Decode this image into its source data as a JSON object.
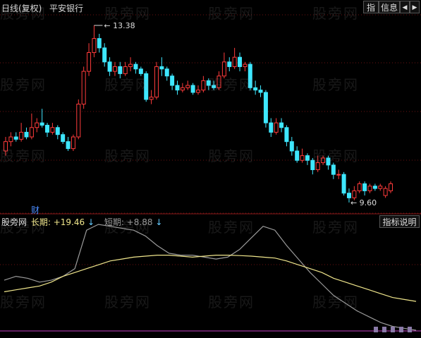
{
  "topbar": {
    "period_label": "日线(复权)",
    "stock_name": "平安银行",
    "btn_index": "指",
    "btn_info": "信息",
    "btn_prev": "◀",
    "btn_next": "▶"
  },
  "price_chart": {
    "high_label": "13.38",
    "low_label": "9.60",
    "high_value": 13.38,
    "low_value": 9.6,
    "finance_marker": "财",
    "colors": {
      "up": "#ff3b3b",
      "down": "#3ee7ff",
      "grid": "#6b1212"
    },
    "candles": [
      {
        "o": 10.7,
        "c": 10.9,
        "h": 11.0,
        "l": 10.6
      },
      {
        "o": 10.9,
        "c": 11.0,
        "h": 11.1,
        "l": 10.8
      },
      {
        "o": 11.0,
        "c": 10.95,
        "h": 11.1,
        "l": 10.9
      },
      {
        "o": 10.95,
        "c": 11.1,
        "h": 11.3,
        "l": 10.9
      },
      {
        "o": 11.1,
        "c": 11.0,
        "h": 11.2,
        "l": 10.95
      },
      {
        "o": 11.0,
        "c": 11.2,
        "h": 11.5,
        "l": 10.95
      },
      {
        "o": 11.2,
        "c": 11.3,
        "h": 11.4,
        "l": 11.1
      },
      {
        "o": 11.3,
        "c": 11.25,
        "h": 11.6,
        "l": 11.2
      },
      {
        "o": 11.25,
        "c": 11.1,
        "h": 11.3,
        "l": 11.0
      },
      {
        "o": 11.1,
        "c": 11.2,
        "h": 11.3,
        "l": 11.05
      },
      {
        "o": 11.2,
        "c": 11.05,
        "h": 11.25,
        "l": 10.95
      },
      {
        "o": 11.05,
        "c": 10.9,
        "h": 11.1,
        "l": 10.85
      },
      {
        "o": 10.9,
        "c": 10.75,
        "h": 11.0,
        "l": 10.7
      },
      {
        "o": 10.75,
        "c": 11.0,
        "h": 11.05,
        "l": 10.7
      },
      {
        "o": 11.0,
        "c": 11.7,
        "h": 11.8,
        "l": 10.95
      },
      {
        "o": 11.7,
        "c": 12.4,
        "h": 12.5,
        "l": 11.6
      },
      {
        "o": 12.4,
        "c": 12.8,
        "h": 13.0,
        "l": 12.3
      },
      {
        "o": 12.8,
        "c": 13.1,
        "h": 13.38,
        "l": 12.7
      },
      {
        "o": 13.1,
        "c": 12.9,
        "h": 13.2,
        "l": 12.8
      },
      {
        "o": 12.9,
        "c": 12.6,
        "h": 13.0,
        "l": 12.5
      },
      {
        "o": 12.6,
        "c": 12.4,
        "h": 12.7,
        "l": 12.3
      },
      {
        "o": 12.4,
        "c": 12.5,
        "h": 12.6,
        "l": 12.3
      },
      {
        "o": 12.5,
        "c": 12.35,
        "h": 12.6,
        "l": 12.25
      },
      {
        "o": 12.35,
        "c": 12.5,
        "h": 12.6,
        "l": 12.3
      },
      {
        "o": 12.5,
        "c": 12.55,
        "h": 12.7,
        "l": 12.4
      },
      {
        "o": 12.55,
        "c": 12.45,
        "h": 12.6,
        "l": 12.35
      },
      {
        "o": 12.45,
        "c": 12.35,
        "h": 12.5,
        "l": 12.3
      },
      {
        "o": 12.35,
        "c": 11.8,
        "h": 12.4,
        "l": 11.75
      },
      {
        "o": 11.8,
        "c": 11.85,
        "h": 12.0,
        "l": 11.7
      },
      {
        "o": 11.85,
        "c": 12.5,
        "h": 12.6,
        "l": 11.8
      },
      {
        "o": 12.5,
        "c": 12.45,
        "h": 12.7,
        "l": 12.3
      },
      {
        "o": 12.45,
        "c": 12.3,
        "h": 12.5,
        "l": 12.2
      },
      {
        "o": 12.3,
        "c": 12.1,
        "h": 12.35,
        "l": 12.0
      },
      {
        "o": 12.1,
        "c": 12.0,
        "h": 12.2,
        "l": 11.9
      },
      {
        "o": 12.0,
        "c": 12.05,
        "h": 12.15,
        "l": 11.95
      },
      {
        "o": 12.05,
        "c": 12.1,
        "h": 12.2,
        "l": 12.0
      },
      {
        "o": 12.1,
        "c": 11.95,
        "h": 12.15,
        "l": 11.9
      },
      {
        "o": 11.95,
        "c": 12.0,
        "h": 12.1,
        "l": 11.9
      },
      {
        "o": 12.0,
        "c": 12.2,
        "h": 12.3,
        "l": 11.95
      },
      {
        "o": 12.2,
        "c": 12.1,
        "h": 12.25,
        "l": 12.0
      },
      {
        "o": 12.1,
        "c": 12.05,
        "h": 12.2,
        "l": 12.0
      },
      {
        "o": 12.05,
        "c": 12.3,
        "h": 12.4,
        "l": 12.0
      },
      {
        "o": 12.3,
        "c": 12.6,
        "h": 12.8,
        "l": 12.25
      },
      {
        "o": 12.6,
        "c": 12.5,
        "h": 12.7,
        "l": 12.4
      },
      {
        "o": 12.5,
        "c": 12.7,
        "h": 12.9,
        "l": 12.45
      },
      {
        "o": 12.7,
        "c": 12.5,
        "h": 12.8,
        "l": 12.4
      },
      {
        "o": 12.5,
        "c": 12.55,
        "h": 12.6,
        "l": 12.4
      },
      {
        "o": 12.55,
        "c": 12.05,
        "h": 12.6,
        "l": 12.0
      },
      {
        "o": 12.05,
        "c": 12.0,
        "h": 12.2,
        "l": 11.9
      },
      {
        "o": 12.0,
        "c": 11.95,
        "h": 12.1,
        "l": 11.85
      },
      {
        "o": 11.95,
        "c": 11.3,
        "h": 12.0,
        "l": 11.2
      },
      {
        "o": 11.3,
        "c": 11.1,
        "h": 11.4,
        "l": 11.0
      },
      {
        "o": 11.1,
        "c": 11.3,
        "h": 11.4,
        "l": 11.05
      },
      {
        "o": 11.3,
        "c": 11.2,
        "h": 11.4,
        "l": 11.1
      },
      {
        "o": 11.2,
        "c": 10.9,
        "h": 11.25,
        "l": 10.8
      },
      {
        "o": 10.9,
        "c": 10.7,
        "h": 11.0,
        "l": 10.6
      },
      {
        "o": 10.7,
        "c": 10.5,
        "h": 10.8,
        "l": 10.45
      },
      {
        "o": 10.5,
        "c": 10.6,
        "h": 10.75,
        "l": 10.45
      },
      {
        "o": 10.6,
        "c": 10.5,
        "h": 10.65,
        "l": 10.4
      },
      {
        "o": 10.5,
        "c": 10.3,
        "h": 10.55,
        "l": 10.2
      },
      {
        "o": 10.3,
        "c": 10.45,
        "h": 10.6,
        "l": 10.25
      },
      {
        "o": 10.45,
        "c": 10.55,
        "h": 10.6,
        "l": 10.4
      },
      {
        "o": 10.55,
        "c": 10.4,
        "h": 10.6,
        "l": 10.3
      },
      {
        "o": 10.4,
        "c": 10.2,
        "h": 10.45,
        "l": 10.1
      },
      {
        "o": 10.2,
        "c": 10.2,
        "h": 10.3,
        "l": 10.1
      },
      {
        "o": 10.2,
        "c": 9.8,
        "h": 10.25,
        "l": 9.75
      },
      {
        "o": 9.8,
        "c": 9.7,
        "h": 9.9,
        "l": 9.6
      },
      {
        "o": 9.7,
        "c": 9.85,
        "h": 9.95,
        "l": 9.65
      },
      {
        "o": 9.85,
        "c": 10.0,
        "h": 10.05,
        "l": 9.8
      },
      {
        "o": 10.0,
        "c": 9.85,
        "h": 10.05,
        "l": 9.75
      },
      {
        "o": 9.85,
        "c": 9.95,
        "h": 10.0,
        "l": 9.8
      },
      {
        "o": 9.95,
        "c": 9.9,
        "h": 10.0,
        "l": 9.85
      },
      {
        "o": 9.9,
        "c": 9.95,
        "h": 10.0,
        "l": 9.85
      },
      {
        "o": 9.75,
        "c": 9.9,
        "h": 9.95,
        "l": 9.7
      },
      {
        "o": 9.85,
        "c": 10.0,
        "h": 10.05,
        "l": 9.8
      }
    ]
  },
  "indicator": {
    "name": "股旁网",
    "long_label": "长期:",
    "long_value": "+19.46",
    "long_arrow": "↓",
    "short_label": "短期:",
    "short_value": "+8.88",
    "short_arrow": "↓",
    "explain_button": "指标说明",
    "long_color": "#f0e68c",
    "short_color": "#9a9a9a",
    "baseline_color": "#c040c0",
    "long_series": [
      8,
      9,
      10,
      11,
      13,
      16,
      18,
      20,
      22,
      24,
      25,
      26,
      26.5,
      27,
      27,
      26.5,
      26,
      26.5,
      27,
      27,
      26.8,
      26.5,
      26,
      25.5,
      24,
      22,
      20,
      18,
      15,
      13,
      11,
      9,
      7,
      5,
      4,
      3
    ],
    "short_series": [
      14,
      16,
      15,
      13,
      14,
      16,
      20,
      40,
      43,
      42,
      41,
      40,
      37,
      32,
      28,
      27,
      27,
      26,
      25,
      26,
      30,
      36,
      42,
      40,
      32,
      25,
      18,
      12,
      6,
      2,
      -2,
      -5,
      -8,
      -10,
      -11,
      -12
    ]
  },
  "watermark": "股旁网"
}
